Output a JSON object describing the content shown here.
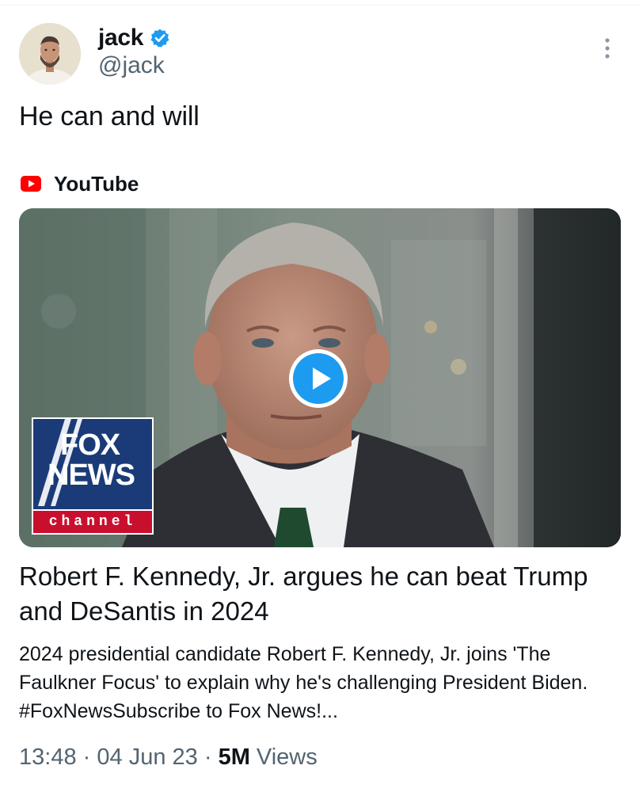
{
  "tweet": {
    "author_name": "jack",
    "handle": "@jack",
    "text": "He can and will",
    "time": "13:48",
    "separator": "·",
    "date": "04 Jun 23",
    "views_count": "5M",
    "views_label": "Views"
  },
  "card": {
    "source": "YouTube",
    "title": "Robert F. Kennedy, Jr. argues he can beat Trump and DeSantis in 2024",
    "description": "2024 presidential candidate Robert F. Kennedy, Jr. joins 'The Faulkner Focus' to explain why he's challenging President Biden. #FoxNewsSubscribe to Fox News!...",
    "logo": {
      "line1": "FOX",
      "line2": "NEWS",
      "line3": "channel"
    }
  },
  "colors": {
    "verified": "#1d9bf0",
    "play": "#1d9bf0",
    "youtube": "#ff0000",
    "secondary_text": "#536471"
  },
  "icons": {
    "verified": "verified-badge-icon",
    "more": "more-options-icon",
    "source": "youtube-icon",
    "play": "play-icon"
  }
}
